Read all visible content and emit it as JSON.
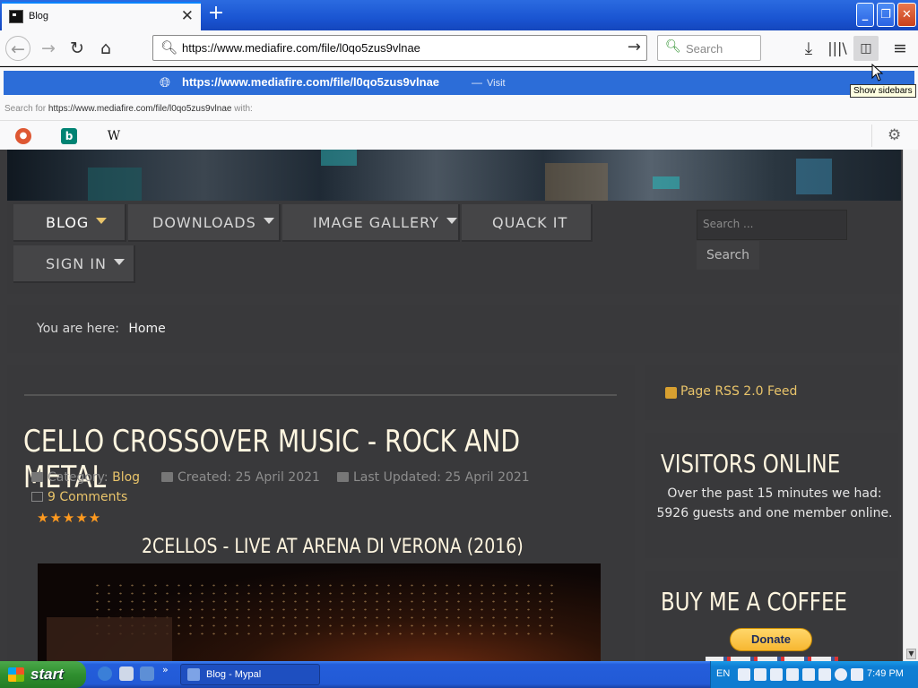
{
  "browser": {
    "tab_title": "Blog",
    "url": "https://www.mediafire.com/file/l0qo5zus9vlnae",
    "search_placeholder": "Search",
    "dropdown_url": "https://www.mediafire.com/file/l0qo5zus9vlnae",
    "dropdown_dash": "—",
    "dropdown_action": "Visit",
    "search_for_prefix": "Search for",
    "search_for_term": "https://www.mediafire.com/file/l0qo5zus9vlnae",
    "search_for_suffix": "with:",
    "engines": {
      "bing": "b",
      "wiki": "W"
    },
    "tooltip": "Show sidebars"
  },
  "site": {
    "menu": {
      "blog": "BLOG",
      "downloads": "DOWNLOADS",
      "gallery": "IMAGE GALLERY",
      "quack": "QUACK IT",
      "signin": "SIGN IN"
    },
    "search_placeholder": "Search ...",
    "search_button": "Search",
    "breadcrumb_prefix": "You are here:",
    "breadcrumb_home": "Home"
  },
  "article": {
    "title": "CELLO CROSSOVER MUSIC - ROCK AND METAL",
    "category_label": "Category:",
    "category": "Blog",
    "created": "Created: 25 April 2021",
    "updated": "Last Updated: 25 April 2021",
    "comments": "9 Comments",
    "rating_stars": "★★★★★",
    "video_title": "2CELLOS - LIVE AT ARENA DI VERONA (2016)"
  },
  "sidebar": {
    "rss": "Page RSS 2.0 Feed",
    "visitors_title": "VISITORS ONLINE",
    "visitors_text": "Over the past 15 minutes we had: 5926 guests and one member online.",
    "coffee_title": "BUY ME A COFFEE",
    "donate": "Donate"
  },
  "taskbar": {
    "start": "start",
    "window": "Blog - Mypal",
    "lang": "EN",
    "time": "7:49 PM"
  },
  "colors": {
    "accent_gold": "#e9c46a",
    "page_bg": "#3a3a3c",
    "xp_blue": "#245edb",
    "dropdown_highlight": "#2c6dd8"
  }
}
